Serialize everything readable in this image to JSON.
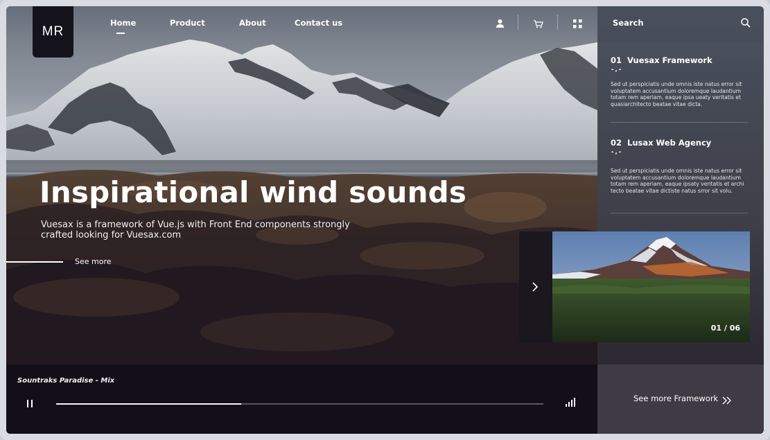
{
  "logo": {
    "text": "MR"
  },
  "nav": {
    "items": [
      {
        "label": "Home",
        "active": true
      },
      {
        "label": "Product"
      },
      {
        "label": "About"
      },
      {
        "label": "Contact us"
      }
    ],
    "icons": [
      "user-icon",
      "cart-icon",
      "grid-icon"
    ]
  },
  "hero": {
    "title": "Inspirational wind sounds",
    "subtitle": "Vuesax is a framework of Vue.js with Front End components strongly crafted looking for Vuesax.com",
    "see_more": "See more"
  },
  "player": {
    "track": "Sountraks Paradise - Mix",
    "progress": 0.38,
    "icons": [
      "pause-icon",
      "volume-bars-icon"
    ]
  },
  "sidebar": {
    "search_label": "Search",
    "cards": [
      {
        "number": "01",
        "title": "Vuesax Framework",
        "sub": "-,-",
        "body": "Sed ut perspiciatis unde omnis iste natus error sit voluptatem accusantium doloremque laudantium totam rem aperiam, eaque ipsa ueaty veritatis et quasiarchitecto beatae vitae dicta."
      },
      {
        "number": "02",
        "title": "Lusax Web Agency",
        "sub": "-,-",
        "body": "Sed ut perspiciatis unde omnis iste natus error sit voluptatem accusantium doloremque laudantium totam rem aperiam, eaque ipsaty veritatis et archi tecto beatae vitae dictiste natus srror sit volu."
      }
    ],
    "see_framework": "See more Framework"
  },
  "slider": {
    "counter": "01 / 06"
  },
  "colors": {
    "dark_bg": "#130f19",
    "sidebar_bg": "#3f3f49",
    "text": "#ffffff"
  }
}
